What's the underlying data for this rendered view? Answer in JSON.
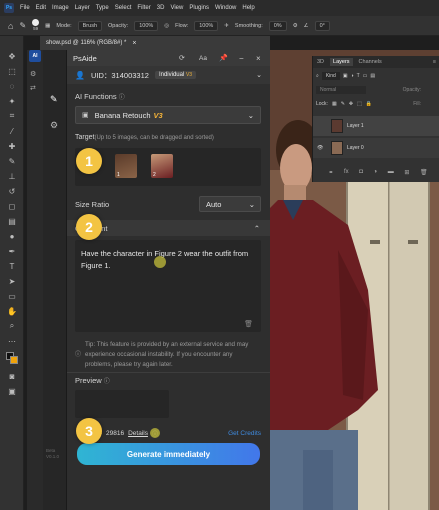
{
  "menubar": {
    "app_icon": "Ps",
    "items": [
      "File",
      "Edit",
      "Image",
      "Layer",
      "Type",
      "Select",
      "Filter",
      "3D",
      "View",
      "Plugins",
      "Window",
      "Help"
    ]
  },
  "options": {
    "brush_size": "59",
    "mode_label": "Mode:",
    "mode_value": "Brush",
    "opacity_label": "Opacity:",
    "opacity_value": "100%",
    "flow_label": "Flow:",
    "flow_value": "100%",
    "smoothing_label": "Smoothing:",
    "smoothing_value": "0%",
    "angle_value": "0°"
  },
  "document": {
    "tab_title": "show.psd @ 116% (RGB/8#) *"
  },
  "plugin_rail": {
    "badge": "AI",
    "version": "Beta\nV0.1.0"
  },
  "psaide": {
    "title": "PsAide",
    "uid_label": "UID：314003312",
    "plan_badge": "Individual",
    "plan_tier": "V3",
    "ai_functions_label": "AI Functions",
    "function_selected": "Banana Retouch",
    "function_version": "V3",
    "target_label": "Target",
    "target_hint": "(Up to 5 images, can be dragged and sorted)",
    "thumb1_num": "1",
    "thumb2_num": "2",
    "size_ratio_label": "Size Ratio",
    "size_ratio_value": "Auto",
    "comment_label": "Comment",
    "comment_text": "Have the character in Figure 2 wear the outfit from Figure 1.",
    "tip_text": "Tip: This feature is provided by an external service and may experience occasional instability. If you encounter any problems, please try again later.",
    "preview_label": "Preview",
    "credits_value": "29816",
    "details_link": "Details",
    "get_credits_link": "Get Credits",
    "generate_button": "Generate immediately",
    "step1": "1",
    "step2": "2",
    "step3": "3",
    "header_refresh": "C",
    "header_translate": "Aa"
  },
  "layers_panel": {
    "tabs": [
      "3D",
      "Layers",
      "Channels"
    ],
    "filter_label": "Kind",
    "blend_mode": "Normal",
    "opacity_label": "Opacity:",
    "lock_label": "Lock:",
    "fill_label": "Fill:",
    "layer1": "Layer 1",
    "layer0": "Layer 0"
  }
}
